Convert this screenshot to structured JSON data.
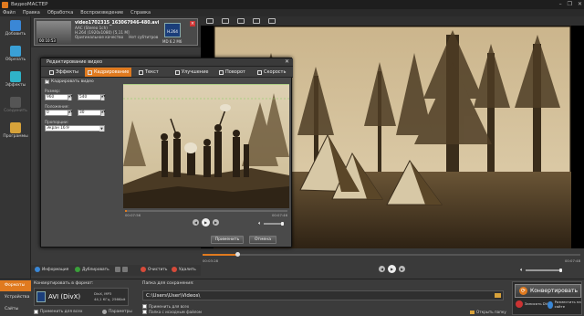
{
  "window": {
    "title": "ВидеоМАСТЕР",
    "controls": [
      "–",
      "❐",
      "✕"
    ]
  },
  "menu": [
    "Файл",
    "Правка",
    "Обработка",
    "Воспроизведение",
    "Справка"
  ],
  "sidebar": {
    "items": [
      {
        "label": "Добавить",
        "icon": "add-icon",
        "color": "#3a87d6"
      },
      {
        "label": "Обрезать",
        "icon": "cut-icon",
        "color": "#3aa0d6"
      },
      {
        "label": "Эффекты",
        "icon": "effects-icon",
        "color": "#2fb3c8"
      },
      {
        "label": "Соединить",
        "icon": "join-icon",
        "color": "#555"
      },
      {
        "label": "Программы",
        "icon": "programs-icon",
        "color": "#d6a23a"
      }
    ]
  },
  "file": {
    "name": "video1702315_163067946-480.avi",
    "audio": "AAC (Stereo 1ch)",
    "video": "H.264 (1920x1080) [5,11 М]",
    "original_quality": "Оригинальное качество",
    "subtitles": "Нет субтитров",
    "duration": "00:10:53",
    "format_badge": "H.264",
    "format_size": "MD 6.2 Мб"
  },
  "dialog": {
    "title": "Редактирование видео",
    "close": "✕",
    "tabs": [
      {
        "label": "Эффекты",
        "icon": "effects-tab-icon",
        "active": false
      },
      {
        "label": "Кадрирование",
        "icon": "crop-tab-icon",
        "active": true
      },
      {
        "label": "Текст",
        "icon": "text-tab-icon",
        "active": false
      },
      {
        "label": "Улучшение",
        "icon": "enhance-tab-icon",
        "active": false
      },
      {
        "label": "Поворот",
        "icon": "rotate-tab-icon",
        "active": false
      },
      {
        "label": "Скорость",
        "icon": "speed-tab-icon",
        "active": false
      }
    ],
    "crop_checkbox": "Кадрировать видео",
    "size_label": "Размер:",
    "size_w": "960",
    "size_h": "540",
    "position_label": "Положение:",
    "pos_x": "0",
    "pos_y": "30",
    "proportions_label": "Пропорции:",
    "proportions_value": "Экран 16:9",
    "time_current": "00:07:56",
    "time_total": "00:07:46",
    "apply": "Применить",
    "cancel": "Отмена"
  },
  "player": {
    "time_current": "00:03:28",
    "time_total": "00:07:48"
  },
  "infobar": {
    "info": "Информация",
    "duplicate": "Дублировать",
    "clear": "Очистить",
    "delete": "Удалить"
  },
  "bottom": {
    "side_items": [
      {
        "label": "Форматы",
        "active": true
      },
      {
        "label": "Устройства",
        "active": false
      },
      {
        "label": "Сайты",
        "active": false
      }
    ],
    "convert_label": "Конвертировать в формат:",
    "format_name": "AVI (DivX)",
    "format_spec1": "DivX, MP3",
    "format_spec2": "44,1 КГц, 256Kbit",
    "apply_all": "Применить для всех",
    "params": "Параметры",
    "save_label": "Папка для сохранения:",
    "save_path": "C:\\Users\\User\\Videos\\",
    "save_cb1": "Применить для всех",
    "save_cb2": "Папка с исходным файлом",
    "open_folder": "Открыть папку",
    "convert_button": "Конвертировать",
    "burn_dvd": "Записать DVD",
    "publish": "Разместить на сайте"
  },
  "colors": {
    "accent": "#e07a1f",
    "sepia_light": "#d9c7a2",
    "sepia_dark": "#3b2e1d"
  }
}
